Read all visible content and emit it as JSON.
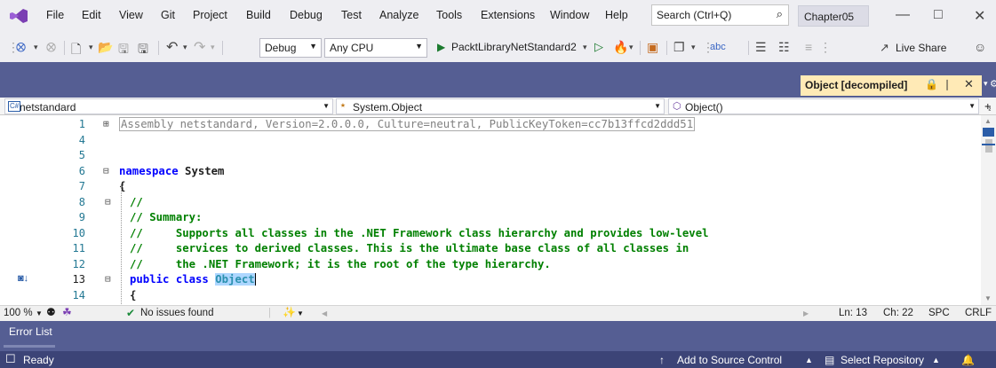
{
  "menu": {
    "items": [
      "File",
      "Edit",
      "View",
      "Git",
      "Project",
      "Build",
      "Debug",
      "Test",
      "Analyze",
      "Tools",
      "Extensions",
      "Window",
      "Help"
    ],
    "search_placeholder": "Search (Ctrl+Q)",
    "solution_name": "Chapter05"
  },
  "toolbar": {
    "config": "Debug",
    "platform": "Any CPU",
    "startup_project": "PacktLibraryNetStandard2",
    "live_share": "Live Share"
  },
  "document_tab": {
    "title": "Object [decompiled]"
  },
  "navbar": {
    "project": "netstandard",
    "type": "System.Object",
    "member": "Object()"
  },
  "code": {
    "lines": [
      {
        "num": "1",
        "text": "Assembly netstandard, Version=2.0.0.0, Culture=neutral, PublicKeyToken=cc7b13ffcd2ddd51"
      },
      {
        "num": "4",
        "text": ""
      },
      {
        "num": "5",
        "text": ""
      },
      {
        "num": "6",
        "kw": "namespace",
        "rest": " System"
      },
      {
        "num": "7",
        "text": "{"
      },
      {
        "num": "8",
        "comment": "//"
      },
      {
        "num": "9",
        "comment": "// Summary:"
      },
      {
        "num": "10",
        "comment": "//     Supports all classes in the .NET Framework class hierarchy and provides low-level"
      },
      {
        "num": "11",
        "comment": "//     services to derived classes. This is the ultimate base class of all classes in"
      },
      {
        "num": "12",
        "comment": "//     the .NET Framework; it is the root of the type hierarchy."
      },
      {
        "num": "13",
        "kw": "public class",
        "rest": " ",
        "sel": "Object"
      },
      {
        "num": "14",
        "text": "{"
      }
    ]
  },
  "editor_status": {
    "zoom": "100 %",
    "issues": "No issues found",
    "line": "Ln: 13",
    "col": "Ch: 22",
    "spc": "SPC",
    "eol": "CRLF"
  },
  "error_list": {
    "title": "Error List"
  },
  "status_bar": {
    "ready": "Ready",
    "add_source_control": "Add to Source Control",
    "select_repository": "Select Repository"
  }
}
